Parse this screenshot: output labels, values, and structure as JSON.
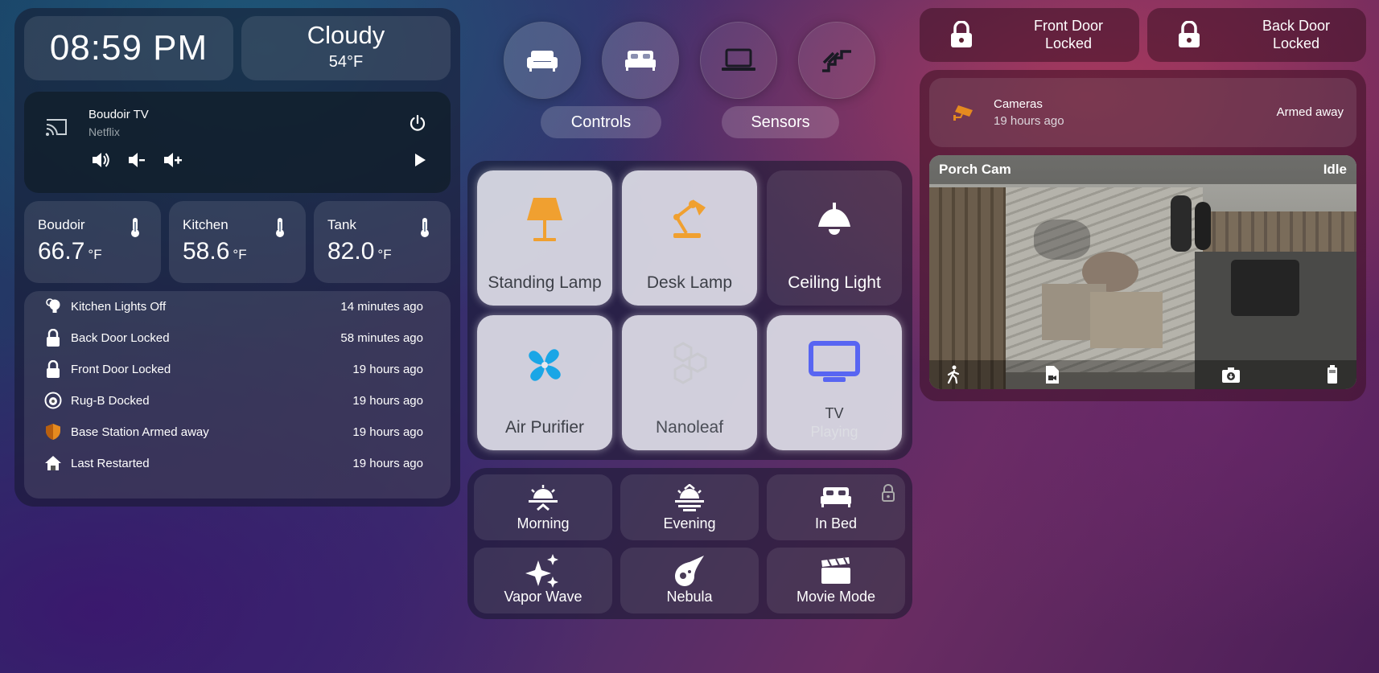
{
  "clock": {
    "time": "08:59 PM"
  },
  "weather": {
    "condition": "Cloudy",
    "temperature": "54°F"
  },
  "media": {
    "title": "Boudoir TV",
    "source": "Netflix"
  },
  "sensors": [
    {
      "name": "Boudoir",
      "value": "66.7",
      "unit": "°F"
    },
    {
      "name": "Kitchen",
      "value": "58.6",
      "unit": "°F"
    },
    {
      "name": "Tank",
      "value": "82.0",
      "unit": "°F"
    }
  ],
  "logbook": [
    {
      "name": "Kitchen Lights Off",
      "time": "14 minutes ago",
      "icon": "lightbulb-icon"
    },
    {
      "name": "Back Door Locked",
      "time": "58 minutes ago",
      "icon": "lock-icon"
    },
    {
      "name": "Front Door Locked",
      "time": "19 hours ago",
      "icon": "lock-icon"
    },
    {
      "name": "Rug-B Docked",
      "time": "19 hours ago",
      "icon": "robot-vacuum-icon"
    },
    {
      "name": "Base Station Armed away",
      "time": "19 hours ago",
      "icon": "shield-icon"
    },
    {
      "name": "Last Restarted",
      "time": "19 hours ago",
      "icon": "home-icon"
    }
  ],
  "room_nav": {
    "icons": [
      "sofa-icon",
      "bed-icon",
      "laptop-icon",
      "stairs-icon"
    ],
    "controls_label": "Controls",
    "sensors_label": "Sensors"
  },
  "devices": [
    {
      "name": "Standing Lamp",
      "icon": "floor-lamp-icon",
      "color": "#f0a030"
    },
    {
      "name": "Desk Lamp",
      "icon": "desk-lamp-icon",
      "color": "#f0a030"
    },
    {
      "name": "Ceiling Light",
      "icon": "ceiling-light-icon",
      "color": "#ffffff"
    },
    {
      "name": "Air Purifier",
      "icon": "fan-icon",
      "color": "#1aa6e6"
    },
    {
      "name": "Nanoleaf",
      "icon": "hexagon-multiple-icon",
      "color": "#c9c9cf"
    },
    {
      "name": "TV",
      "state": "Playing",
      "icon": "television-icon",
      "color": "#5865f2"
    }
  ],
  "scenes": [
    {
      "name": "Morning",
      "icon": "sunrise-icon"
    },
    {
      "name": "Evening",
      "icon": "sunset-icon"
    },
    {
      "name": "In Bed",
      "icon": "bed-icon"
    },
    {
      "name": "Vapor Wave",
      "icon": "sparkles-icon"
    },
    {
      "name": "Nebula",
      "icon": "comet-icon"
    },
    {
      "name": "Movie Mode",
      "icon": "clapperboard-icon"
    }
  ],
  "locks": [
    {
      "name": "Front Door",
      "state": "Locked"
    },
    {
      "name": "Back Door",
      "state": "Locked"
    }
  ],
  "alarm": {
    "name": "Cameras",
    "last_changed": "19 hours ago",
    "state": "Armed away",
    "icon_color": "#e58a1f"
  },
  "camera": {
    "name": "Porch Cam",
    "state": "Idle"
  }
}
